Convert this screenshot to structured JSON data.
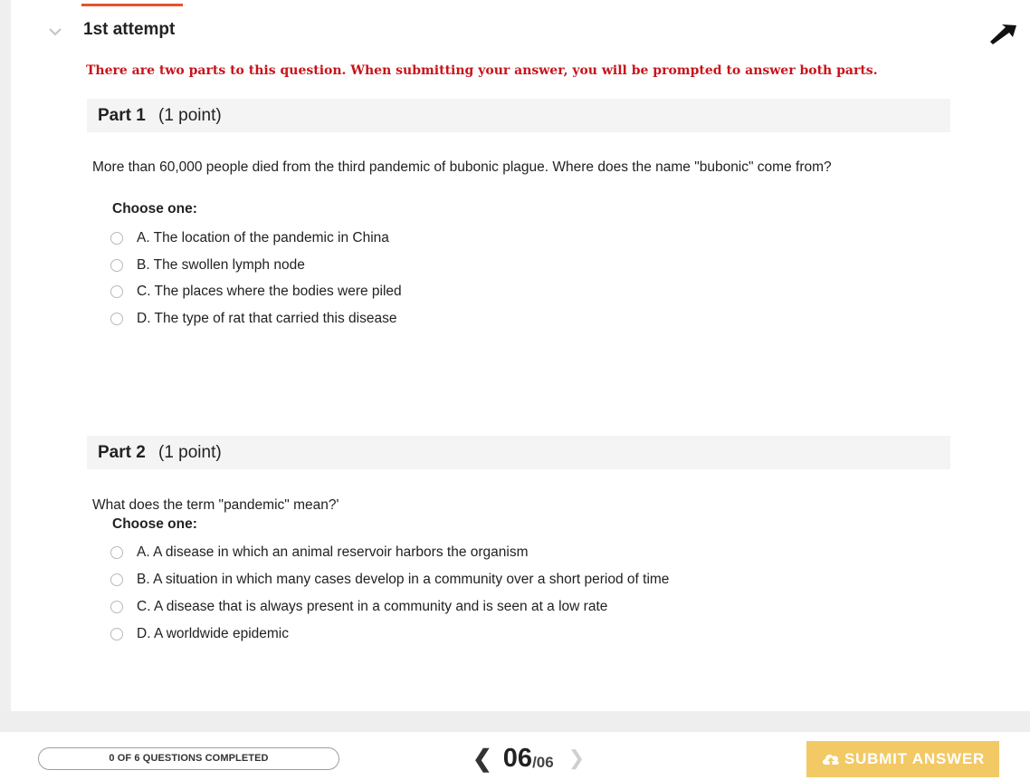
{
  "attempt": {
    "title": "1st attempt"
  },
  "notice": "There are two parts to this question. When submitting your answer, you will be prompted to answer both parts.",
  "parts": [
    {
      "label": "Part 1",
      "points": "(1 point)",
      "question": "More than 60,000 people died from the third pandemic of bubonic plague. Where does the name \"bubonic\" come from?",
      "choose_label": "Choose one:",
      "options": [
        "A. The location of the pandemic in China",
        "B. The swollen lymph node",
        "C. The places where the bodies were piled",
        "D. The type of rat that carried this disease"
      ]
    },
    {
      "label": "Part 2",
      "points": "(1 point)",
      "question": "What does the term \"pandemic\" mean?'",
      "choose_label": "Choose one:",
      "options": [
        "A. A disease in which an animal reservoir harbors the organism",
        "B. A situation in which many cases develop in a community over a short period of time",
        "C. A disease that is always present in a community and is seen at a low rate",
        "D. A worldwide epidemic"
      ]
    }
  ],
  "footer": {
    "progress_text": "0 OF 6 QUESTIONS COMPLETED",
    "progress_fraction": 0,
    "pager_current": "06",
    "pager_total": "/06",
    "submit_label": "SUBMIT ANSWER"
  },
  "colors": {
    "notice": "#c8131b",
    "accent": "#e8522b",
    "submit_bg": "#f2c964"
  },
  "icons": {
    "collapse": "chevron-down-icon",
    "corner": "arrow-icon",
    "prev": "chevron-left-icon",
    "next": "chevron-right-icon",
    "submit": "cloud-upload-icon"
  }
}
